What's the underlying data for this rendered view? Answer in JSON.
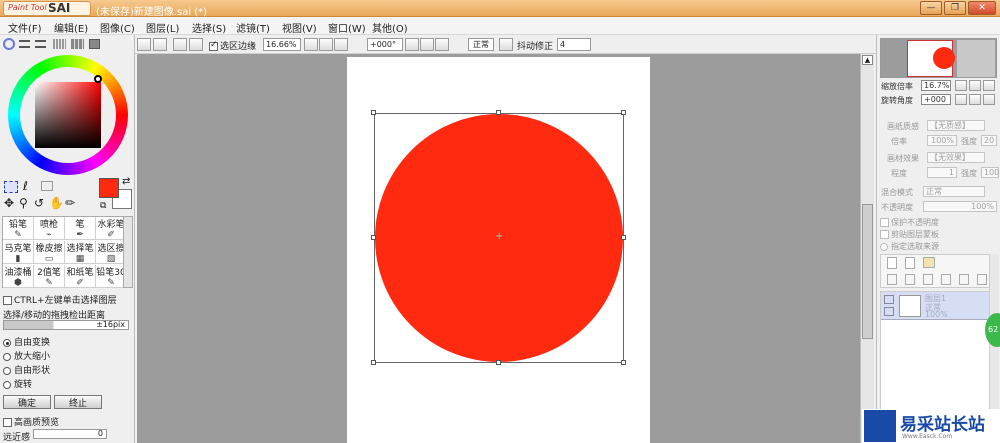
{
  "titlebar": {
    "logo_small": "Paint Tool",
    "logo_big": "SAI",
    "title": "(未保存)新建图像.sai (*)",
    "min": "—",
    "restore": "❐",
    "close": "✕"
  },
  "menu": [
    {
      "label": "文件(F)"
    },
    {
      "label": "编辑(E)"
    },
    {
      "label": "图像(C)"
    },
    {
      "label": "图层(L)"
    },
    {
      "label": "选择(S)"
    },
    {
      "label": "滤镜(T)"
    },
    {
      "label": "视图(V)"
    },
    {
      "label": "窗口(W)"
    },
    {
      "label": "其他(O)"
    }
  ],
  "toolbar": {
    "selection_edge_label": "选区边缘",
    "zoom_value": "16.66%",
    "rotate_value": "+000°",
    "blend_mode": "正常",
    "stabilizer_label": "抖动修正",
    "stabilizer_value": "4"
  },
  "left": {
    "color_accent": "#ff2a10",
    "ctrl_click_label": "CTRL+左键单击选择图层",
    "drag_distance_label": "选择/移动的拖拽检出距离",
    "drag_distance_value": "±16pix",
    "transform_options": [
      {
        "label": "自由变换",
        "selected": true
      },
      {
        "label": "放大缩小",
        "selected": false
      },
      {
        "label": "自由形状",
        "selected": false
      },
      {
        "label": "旋转",
        "selected": false
      }
    ],
    "ok_button": "确定",
    "cancel_button": "终止",
    "hq_preview_label": "高画质预览",
    "perspective_label": "远近感",
    "perspective_value": "0",
    "brushes": [
      {
        "label": "铅笔",
        "icon": "✎"
      },
      {
        "label": "喷枪",
        "icon": "⌁"
      },
      {
        "label": "笔",
        "icon": "✒"
      },
      {
        "label": "水彩笔",
        "icon": "✐"
      },
      {
        "label": "马克笔",
        "icon": "▮"
      },
      {
        "label": "橡皮擦",
        "icon": "▭"
      },
      {
        "label": "选择笔",
        "icon": "▦"
      },
      {
        "label": "选区擦",
        "icon": "▧"
      },
      {
        "label": "油漆桶",
        "icon": "⬢"
      },
      {
        "label": "2值笔",
        "icon": "✎"
      },
      {
        "label": "和纸笔",
        "icon": "✐"
      },
      {
        "label": "铅笔30",
        "icon": "✎"
      }
    ]
  },
  "canvas": {
    "circle_color": "#ff2a10"
  },
  "right": {
    "zoom_label": "缩放倍率",
    "zoom_value": "16.7%",
    "rotate_label": "旋转角度",
    "rotate_value": "+000",
    "paper_texture_label": "画纸质感",
    "paper_texture_value": "【无质感】",
    "scale_label": "倍率",
    "scale_value": "100%",
    "strength_label": "强度",
    "strength_value": "20",
    "paper_effect_label": "画材效果",
    "paper_effect_value": "【无效果】",
    "degree_label": "程度",
    "degree_value": "1",
    "strength2_value": "100",
    "blend_label": "混合模式",
    "blend_value": "正常",
    "opacity_label": "不透明度",
    "opacity_value": "100%",
    "protect_opacity": "保护不透明度",
    "clip_layer": "剪贴图层蒙板",
    "selection_source": "指定选取来源",
    "layer_name": "图层1",
    "layer_mode": "正常",
    "layer_opacity": "100%"
  },
  "watermark": {
    "text": "易采站长站",
    "sub": "Www.Easck.Com"
  }
}
